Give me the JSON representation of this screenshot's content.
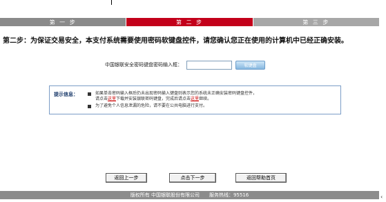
{
  "steps": {
    "step1": "第 一 步",
    "step2": "第 二 步",
    "step3": "第 三 步",
    "active": 2
  },
  "heading": {
    "label": "第二步：",
    "text": "为保证交易安全，本支付系统需要使用密码软键盘控件，请您确认您正在使用的计算机中已经正确安装。"
  },
  "password": {
    "label": "中国银联安全密码键盘密码输入框：",
    "value": "",
    "keyboard_button": "软键盘"
  },
  "tips": {
    "title": "提示信息：",
    "line1": "如果单击密码输入框后仍未出现密码输入键盘则表示您的系统未正确安装密码键盘控件，",
    "line2_a": "请点击",
    "line2_link1": "这里",
    "line2_b": "下载并安装银联密码键盘，完成后请点击",
    "line2_link2": "这里",
    "line2_c": "继续。",
    "line3": "为了避免个人信息泄漏的危险，请不要在公共电脑进行支付。"
  },
  "buttons": {
    "prev": "返回上一步",
    "next": "点击下一步",
    "help": "返回帮助首页"
  },
  "footer": {
    "copyright": "版权所有 中国银联股份有限公司",
    "hotline": "服务热线：95516"
  },
  "colors": {
    "active_step": "#c3001a",
    "inactive_step": "#8a8a8a",
    "footer": "#8c8c8c",
    "tip_border": "#7a9cc6"
  }
}
